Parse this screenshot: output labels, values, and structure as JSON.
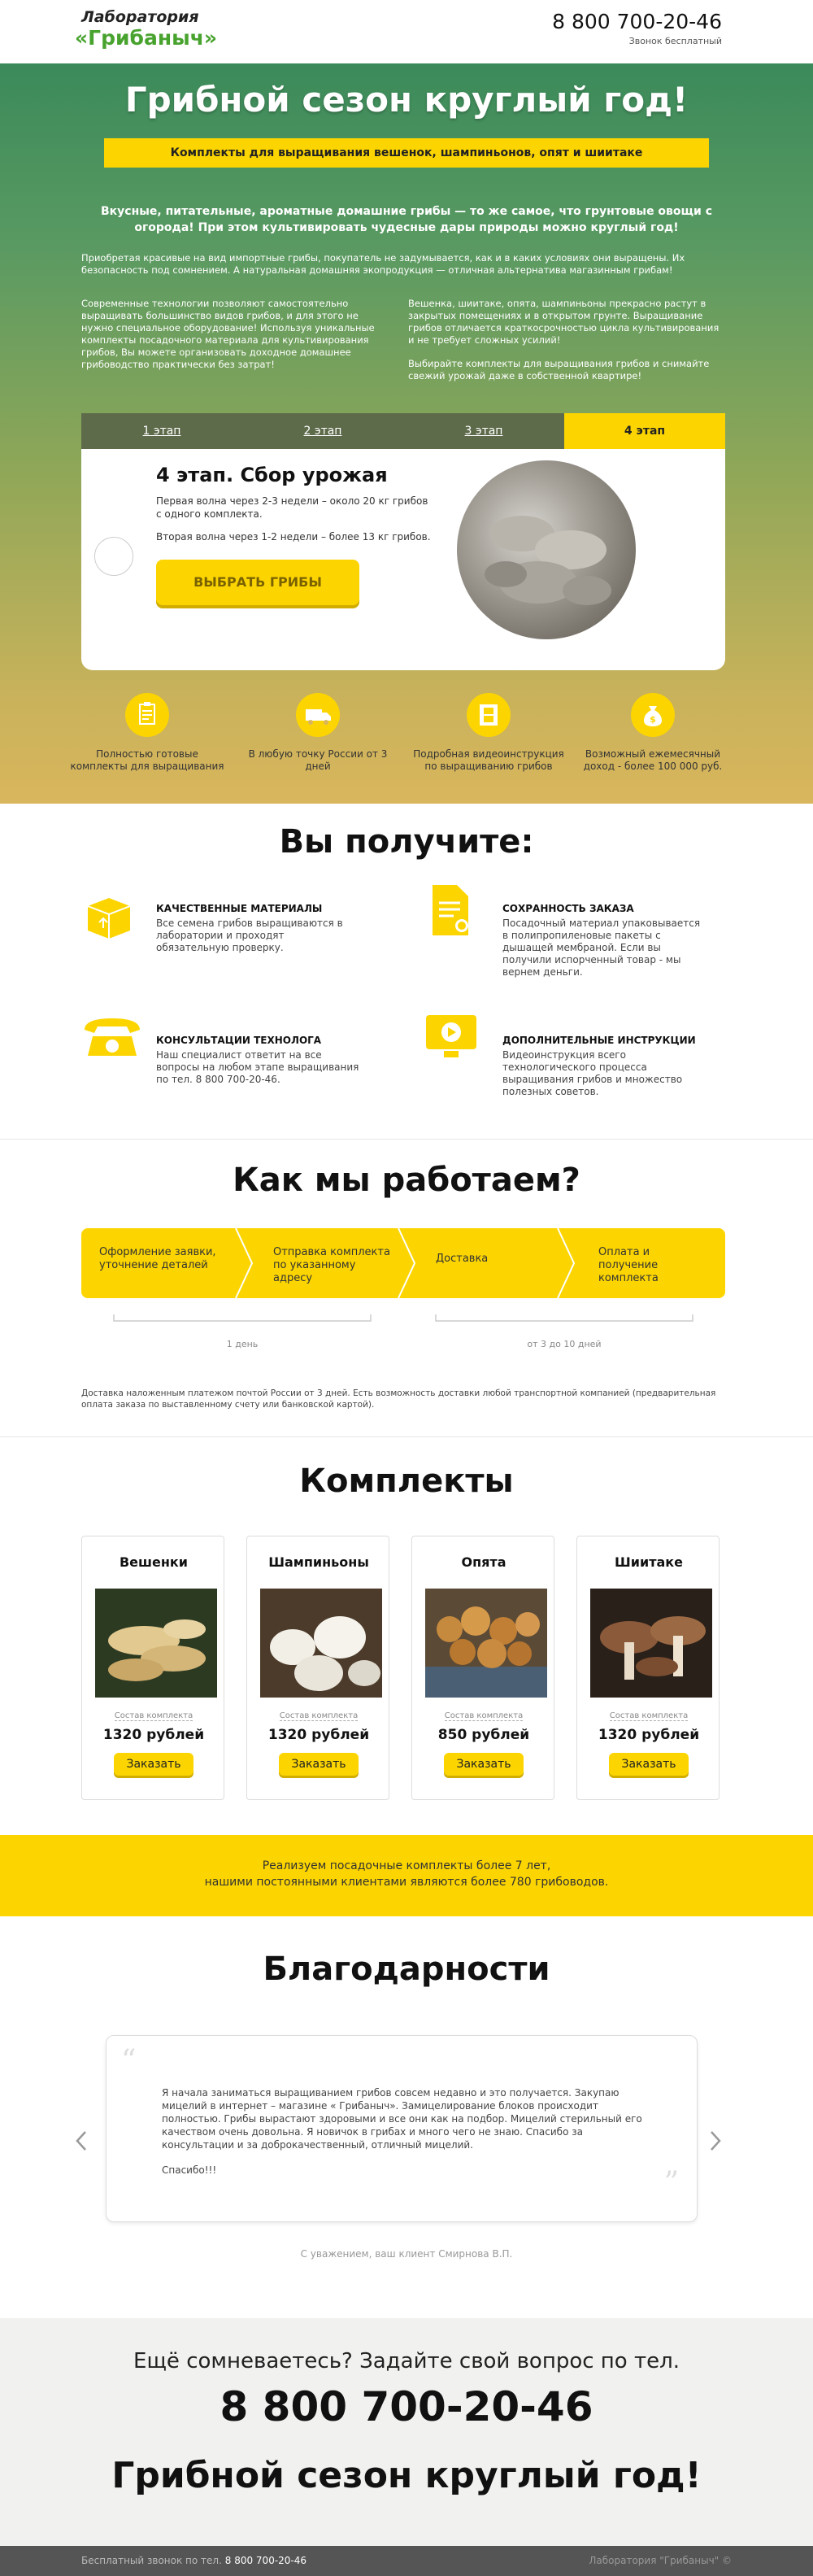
{
  "header": {
    "logo_line1": "Лаборатория",
    "logo_line2": "«Грибаныч»",
    "phone": "8 800 700-20-46",
    "phone_note": "Звонок бесплатный"
  },
  "hero": {
    "title": "Грибной сезон круглый год!",
    "ribbon": "Комплекты для выращивания вешенок, шампиньонов, опят и шиитаке",
    "lead": "Вкусные, питательные, ароматные домашние грибы — то же самое, что грунтовые овощи с огорода! При этом культивировать чудесные дары природы можно круглый год!",
    "para1": "Приобретая красивые на вид импортные грибы, покупатель не задумывается, как и в каких условиях они выращены. Их безопасность под сомнением. А натуральная домашняя экопродукция — отличная альтернатива магазинным грибам!",
    "col_left": "Современные технологии позволяют самостоятельно выращивать большинство видов грибов, и для этого не нужно специальное оборудование! Используя уникальные комплекты посадочного материала для культивирования грибов, Вы можете организовать доходное домашнее грибоводство практически без затрат!",
    "col_right1": "Вешенка, шиитаке, опята, шампиньоны прекрасно растут в закрытых помещениях и в открытом грунте. Выращивание грибов отличается краткосрочностью цикла культивирования и не требует сложных усилий!",
    "col_right2": "Выбирайте комплекты для выращивания грибов и снимайте свежий урожай даже в собственной квартире!"
  },
  "tabs": [
    "1 этап",
    "2 этап",
    "3 этап",
    "4 этап"
  ],
  "stage": {
    "title": "4 этап. Сбор урожая",
    "p1": "Первая волна через 2-3 недели – около 20 кг грибов с одного комплекта.",
    "p2": "Вторая волна через 1-2 недели – более 13 кг грибов.",
    "button": "ВЫБРАТЬ ГРИБЫ"
  },
  "benefits": [
    {
      "icon": "clipboard-icon",
      "text": "Полностью готовые комплекты для выращивания"
    },
    {
      "icon": "truck-icon",
      "text": "В любую точку России от 3 дней"
    },
    {
      "icon": "film-icon",
      "text": "Подробная видеоинструкция по выращиванию грибов"
    },
    {
      "icon": "money-bag-icon",
      "text": "Возможный ежемесячный доход - более 100 000 руб."
    }
  ],
  "get": {
    "title": "Вы получите:",
    "items": [
      {
        "icon": "box-icon",
        "title": "КАЧЕСТВЕННЫЕ МАТЕРИАЛЫ",
        "text": "Все семена грибов выращиваются в лаборатории и проходят обязательную проверку."
      },
      {
        "icon": "document-icon",
        "title": "СОХРАННОСТЬ ЗАКАЗА",
        "text": "Посадочный материал упаковывается в полипропиленовые пакеты с дышащей мембраной. Если вы получили испорченный товар - мы вернем деньги."
      },
      {
        "icon": "telephone-icon",
        "title": "КОНСУЛЬТАЦИИ ТЕХНОЛОГА",
        "text": "Наш специалист ответит на все вопросы на любом этапе выращивания по тел. 8 800 700-20-46."
      },
      {
        "icon": "video-icon",
        "title": "ДОПОЛНИТЕЛЬНЫЕ ИНСТРУКЦИИ",
        "text": "Видеоинструкция всего технологического процесса выращивания грибов и множество полезных советов."
      }
    ]
  },
  "how": {
    "title": "Как мы работаем?",
    "steps": [
      "Оформление заявки, уточнение деталей",
      "Отправка комплекта по указанному адресу",
      "Доставка",
      "Оплата и получение комплекта"
    ],
    "dur1": "1 день",
    "dur2": "от 3 до 10 дней",
    "note": "Доставка наложенным платежом почтой России от 3 дней. Есть возможность доставки любой транспортной компанией (предварительная оплата заказа по выставленному счету или банковской картой)."
  },
  "kits": {
    "title": "Комплекты",
    "link_label": "Состав комплекта",
    "order_label": "Заказать",
    "items": [
      {
        "name": "Вешенки",
        "price": "1320 рублей"
      },
      {
        "name": "Шампиньоны",
        "price": "1320 рублей"
      },
      {
        "name": "Опята",
        "price": "850 рублей"
      },
      {
        "name": "Шиитаке",
        "price": "1320 рублей"
      }
    ]
  },
  "banner": {
    "line1": "Реализуем посадочные комплекты более 7 лет,",
    "line2": "нашими постоянными клиентами являются более 780 грибоводов."
  },
  "thanks": {
    "title": "Благодарности",
    "quote": "Я начала заниматься выращиванием грибов совсем недавно и это получается. Закупаю мицелий в интернет – магазине « Грибаныч». Замицелирование блоков происходит полностью. Грибы вырастают здоровыми и все они как на подбор. Мицелий стерильный его качеством очень довольна. Я новичок в грибах и много чего не знаю. Спасибо за консультации и за доброкачественный, отличный мицелий.",
    "thanks_word": "Спасибо!!!",
    "signature": "С уважением, ваш клиент Смирнова В.П."
  },
  "bottom": {
    "question": "Ещё сомневаетесь? Задайте свой вопрос по тел.",
    "phone": "8 800 700-20-46",
    "slogan": "Грибной сезон круглый год!"
  },
  "footer": {
    "left_label": "Бесплатный звонок по тел.",
    "left_phone": "8 800 700-20-46",
    "right": "Лаборатория \"Грибаныч\" ©"
  },
  "colors": {
    "accent": "#fcd500",
    "green": "#48a32e",
    "hero_top": "#3b8a5a",
    "hero_bottom": "#d9b65d"
  }
}
